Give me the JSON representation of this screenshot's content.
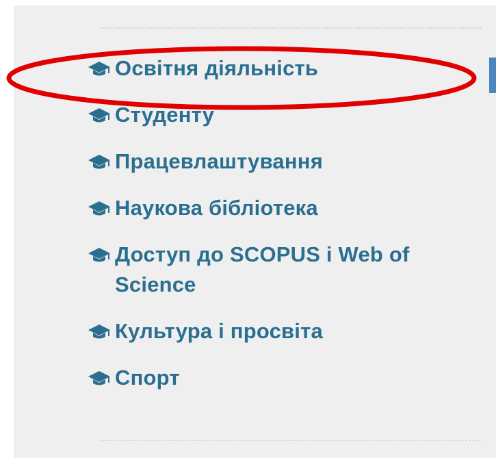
{
  "menu": {
    "items": [
      {
        "label": "Освітня діяльність",
        "icon": "graduation-cap-icon",
        "highlighted": true
      },
      {
        "label": "Студенту",
        "icon": "graduation-cap-icon"
      },
      {
        "label": "Працевлаштування",
        "icon": "graduation-cap-icon"
      },
      {
        "label": "Наукова бібліотека",
        "icon": "graduation-cap-icon"
      },
      {
        "label": "Доступ до SCOPUS і Web of Science",
        "icon": "graduation-cap-icon"
      },
      {
        "label": "Культура і просвіта",
        "icon": "graduation-cap-icon"
      },
      {
        "label": "Спорт",
        "icon": "graduation-cap-icon"
      }
    ]
  },
  "colors": {
    "link": "#2a6f90",
    "panel_background": "#efefef",
    "highlight": "#e00000",
    "side_tab": "#4d86bf"
  }
}
